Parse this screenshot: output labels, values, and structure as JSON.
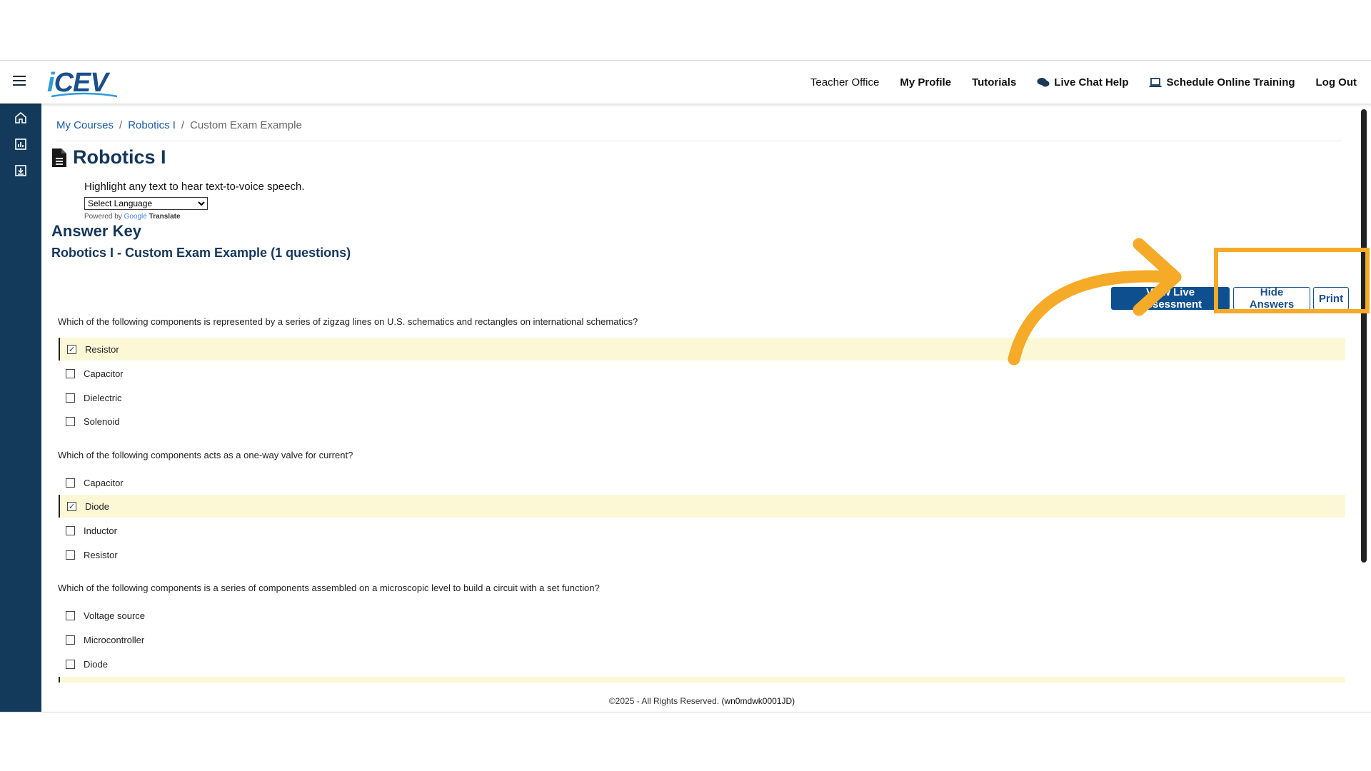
{
  "header": {
    "logo_text": "CEV",
    "logo_prefix": "i",
    "nav": [
      {
        "label": "Teacher Office",
        "icon": null
      },
      {
        "label": "My Profile",
        "icon": null
      },
      {
        "label": "Tutorials",
        "icon": null
      },
      {
        "label": "Live Chat Help",
        "icon": "chat-bubbles-icon"
      },
      {
        "label": "Schedule Online Training",
        "icon": "laptop-icon"
      },
      {
        "label": "Log Out",
        "icon": null
      }
    ]
  },
  "sidebar": {
    "icons": [
      "home-icon",
      "report-chart-icon",
      "download-tray-icon"
    ]
  },
  "breadcrumb": {
    "items": [
      "My Courses",
      "Robotics I",
      "Custom Exam Example"
    ]
  },
  "page": {
    "title": "Robotics I",
    "tts_hint": "Highlight any text to hear text-to-voice speech.",
    "language_select": "Select Language",
    "powered_by": "Powered by",
    "google": "Google",
    "translate": "Translate",
    "answer_key": "Answer Key",
    "exam_title": "Robotics I - Custom Exam Example (1 questions)"
  },
  "actions": {
    "view_label": "View Live Assessment",
    "hide_answers": "Hide Answers",
    "print": "Print"
  },
  "questions": [
    {
      "text": "Which of the following components is represented by a series of zigzag lines on U.S. schematics and rectangles on international schematics?",
      "options": [
        {
          "label": "Resistor",
          "correct": true
        },
        {
          "label": "Capacitor",
          "correct": false
        },
        {
          "label": "Dielectric",
          "correct": false
        },
        {
          "label": "Solenoid",
          "correct": false
        }
      ]
    },
    {
      "text": "Which of the following components acts as a one-way valve for current?",
      "options": [
        {
          "label": "Capacitor",
          "correct": false
        },
        {
          "label": "Diode",
          "correct": true
        },
        {
          "label": "Inductor",
          "correct": false
        },
        {
          "label": "Resistor",
          "correct": false
        }
      ]
    },
    {
      "text": "Which of the following components is a series of components assembled on a microscopic level to build a circuit with a set function?",
      "options": [
        {
          "label": "Voltage source",
          "correct": false
        },
        {
          "label": "Microcontroller",
          "correct": false
        },
        {
          "label": "Diode",
          "correct": false
        }
      ]
    }
  ],
  "footer": {
    "copyright": "©2025 - All Rights Reserved.",
    "code": "(wn0mdwk0001JD)"
  },
  "colors": {
    "brand": "#14365a",
    "sidebar": "#143a5b",
    "correct_bg": "#fcf8d5",
    "annotation": "#f5aa28"
  }
}
